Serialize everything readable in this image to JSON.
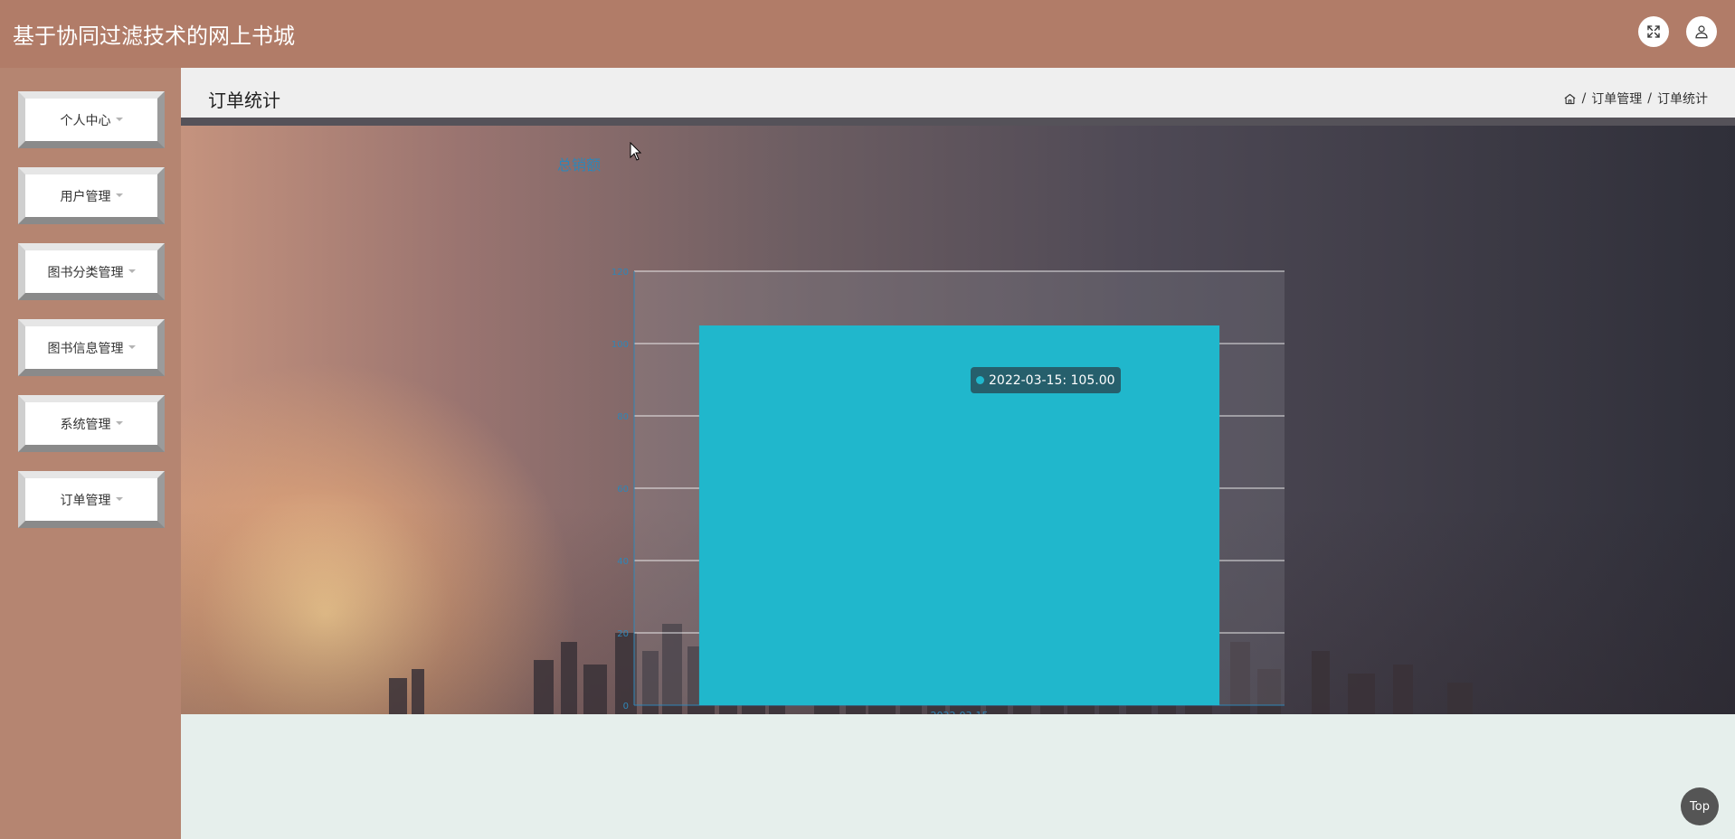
{
  "app": {
    "title": "基于协同过滤技术的网上书城"
  },
  "header": {
    "fullscreen_icon": "fullscreen-icon",
    "user_icon": "user-icon"
  },
  "sidebar": {
    "items": [
      {
        "label": "个人中心"
      },
      {
        "label": "用户管理"
      },
      {
        "label": "图书分类管理"
      },
      {
        "label": "图书信息管理"
      },
      {
        "label": "系统管理"
      },
      {
        "label": "订单管理"
      }
    ]
  },
  "page": {
    "title": "订单统计",
    "breadcrumb": {
      "home_icon": "home-icon",
      "items": [
        "订单管理",
        "订单统计"
      ],
      "separator": "/"
    }
  },
  "chart_data": {
    "type": "bar",
    "title": "总销额",
    "categories": [
      "2022-03-15"
    ],
    "values": [
      105.0
    ],
    "ylim": [
      0,
      120
    ],
    "yticks": [
      0,
      20,
      40,
      60,
      80,
      100,
      120
    ],
    "grid": true,
    "bar_color": "#20b7cc",
    "axis_color": "#2f86b7",
    "tooltip": "2022-03-15: 105.00"
  },
  "back_to_top": {
    "label": "Top"
  },
  "colors": {
    "header": "#b17c68",
    "sidebar": "#b58571",
    "accent": "#20b7cc"
  }
}
